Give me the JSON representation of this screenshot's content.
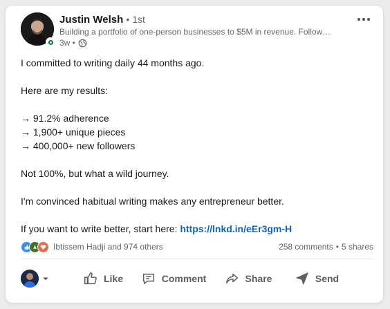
{
  "post": {
    "author": {
      "name": "Justin Welsh",
      "degree": "• 1st",
      "headline": "Building a portfolio of one-person businesses to $5M in revenue. Follow…",
      "timestamp": "3w •",
      "visibility_icon": "globe-icon",
      "online_status": "open-to-work-badge"
    },
    "body": [
      "I committed to writing daily 44 months ago.",
      "",
      "Here are my results:",
      "",
      "→ 91.2% adherence",
      "→ 1,900+ unique pieces",
      "→ 400,000+ new followers",
      "",
      "Not 100%, but what a wild journey.",
      "",
      "I'm convinced habitual writing makes any entrepreneur better.",
      ""
    ],
    "cta_text": "If you want to write better, start here: ",
    "cta_link": "https://lnkd.in/eEr3gm-H",
    "social": {
      "reactions": [
        "like-icon",
        "celebrate-icon",
        "love-icon"
      ],
      "reactors_text": "Ibtissem Hadji and 974 others",
      "comments": "258 comments",
      "separator": "•",
      "shares": "5 shares"
    },
    "actions": {
      "like": "Like",
      "comment": "Comment",
      "share": "Share",
      "send": "Send"
    }
  },
  "colors": {
    "link": "#0a66c2",
    "like_blue": "#378fe9",
    "celebrate_green": "#44712e",
    "love_red": "#df704d",
    "online_green": "#057642"
  }
}
